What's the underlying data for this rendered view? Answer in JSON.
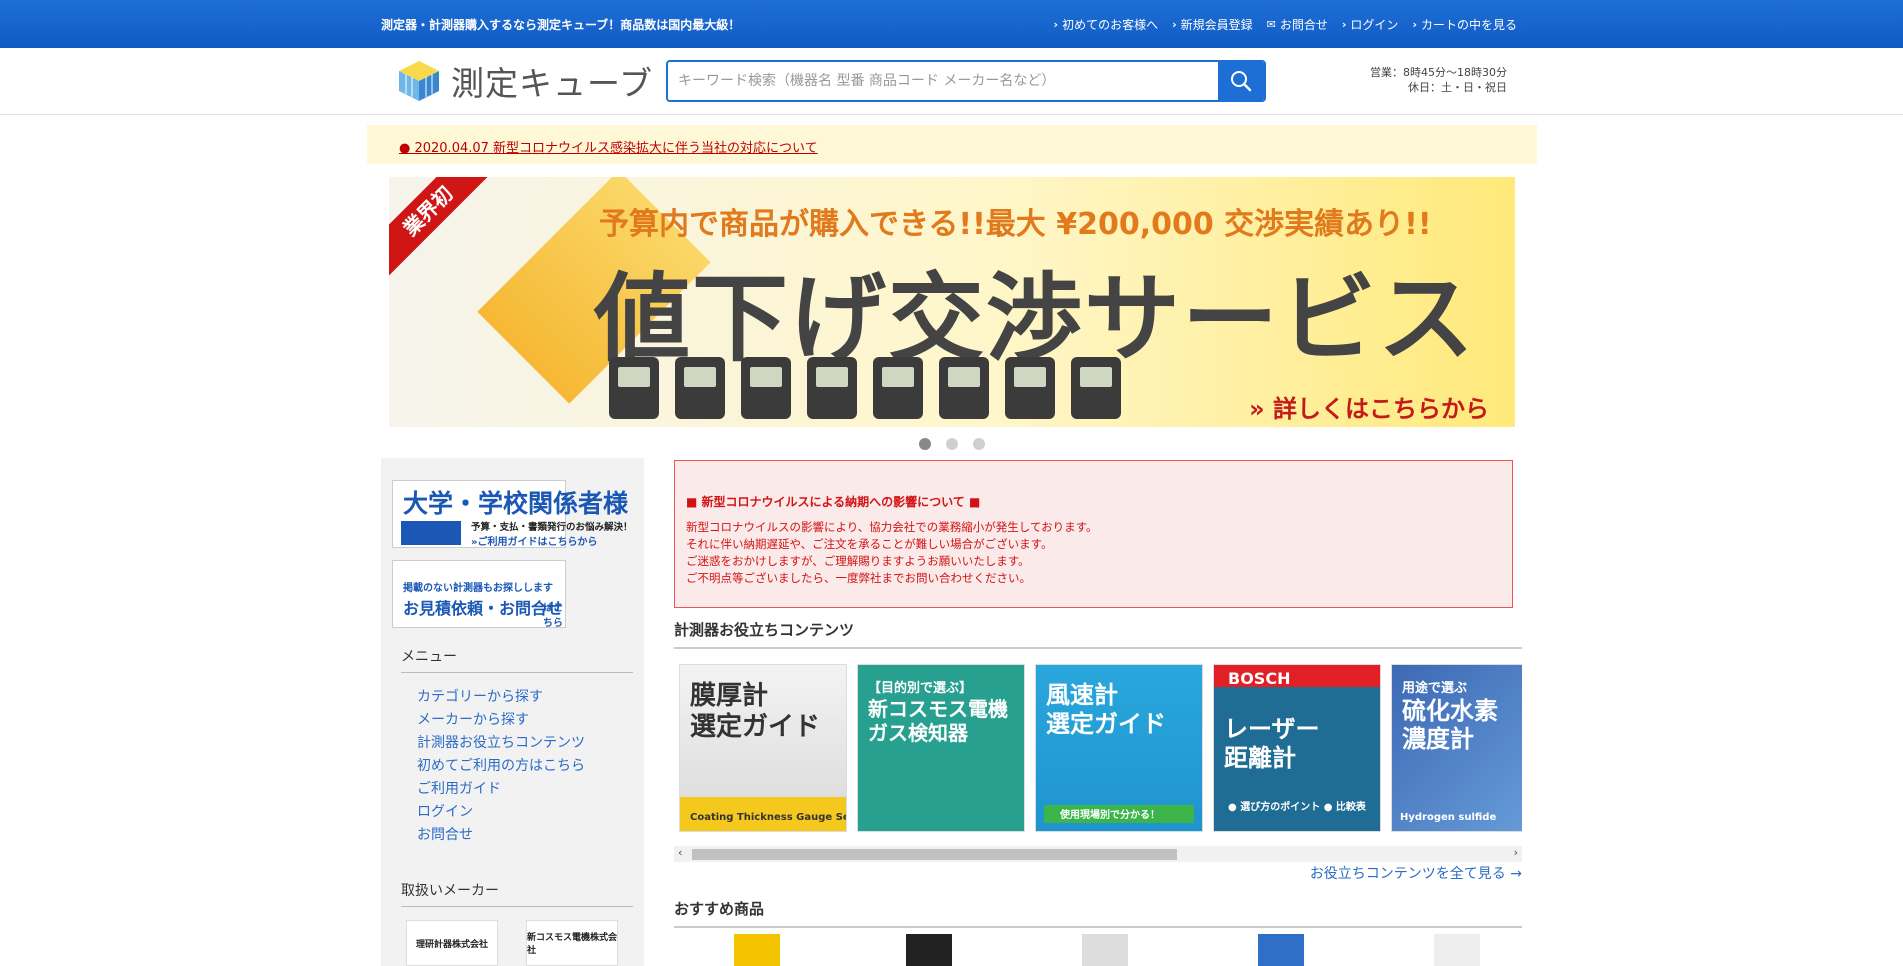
{
  "topbar": {
    "tagline": "測定器・計測器購入するなら測定キューブ！商品数は国内最大級！",
    "links": [
      "初めてのお客様へ",
      "新規会員登録",
      "お問合せ",
      "ログイン",
      "カートの中を見る"
    ]
  },
  "header": {
    "logo_text": "測定キューブ",
    "search_placeholder": "キーワード検索（機器名 型番 商品コード メーカー名など）",
    "hours_line1": "営業：8時45分〜18時30分",
    "hours_line2": "休日：土・日・祝日"
  },
  "notice": {
    "text": "● 2020.04.07 新型コロナウイルス感染拡大に伴う当社の対応について"
  },
  "banner": {
    "ribbon": "業界初",
    "sub": "予算内で商品が購入できる!!最大 ¥200,000 交渉実績あり!!",
    "main": "値下げ交渉サービス",
    "more": "詳しくはこちらから"
  },
  "sidebar": {
    "promo1_title": "大学・学校関係者様",
    "promo1_sub": "予算・支払・書類発行のお悩み解決！",
    "promo1_link": "»ご利用ガイドはこちらから",
    "promo2_line1": "掲載のない計測器もお探しします",
    "promo2_line2": "お見積依頼・お問合せ",
    "promo2_suffix": "はこちら",
    "menu_heading": "メニュー",
    "menu": [
      "カテゴリーから探す",
      "メーカーから探す",
      "計測器お役立ちコンテンツ",
      "初めてご利用の方はこちら",
      "ご利用ガイド",
      "ログイン",
      "お問合せ"
    ],
    "makers_heading": "取扱いメーカー",
    "makers": [
      "理研計器株式会社",
      "新コスモス電機株式会社"
    ]
  },
  "alert": {
    "title": "■ 新型コロナウイルスによる納期への影響について ■",
    "lines": [
      "新型コロナウイルスの影響により、協力会社での業務縮小が発生しております。",
      "それに伴い納期遅延や、ご注文を承ることが難しい場合がございます。",
      "ご迷惑をおかけしますが、ご理解賜りますようお願いいたします。",
      "ご不明点等ございましたら、一度弊社までお問い合わせください。"
    ]
  },
  "contents": {
    "heading": "計測器お役立ちコンテンツ",
    "cards": [
      {
        "title_l1": "膜厚計",
        "title_l2": "選定ガイド",
        "sub": "Coating Thickness Gauge Select guide"
      },
      {
        "title_l0": "【目的別で選ぶ】",
        "title_l1": "新コスモス電機",
        "title_l2": "ガス検知器"
      },
      {
        "title_l1": "風速計",
        "title_l2": "選定ガイド",
        "sub": "使用現場別で分かる！"
      },
      {
        "brand": "BOSCH",
        "title_l1": "レーザー",
        "title_l2": "距離計",
        "sub": "● 選び方のポイント ● 比較表"
      },
      {
        "title_l0": "用途で選ぶ",
        "title_l1": "硫化水素",
        "title_l2": "濃度計",
        "sub": "Hydrogen sulfide"
      }
    ],
    "view_all": "お役立ちコンテンツを全て見る →"
  },
  "products": {
    "heading": "おすすめ商品"
  },
  "colors": {
    "brand_blue": "#1d6fd6",
    "alert_red": "#d31313",
    "link_blue": "#2b6cc6"
  }
}
